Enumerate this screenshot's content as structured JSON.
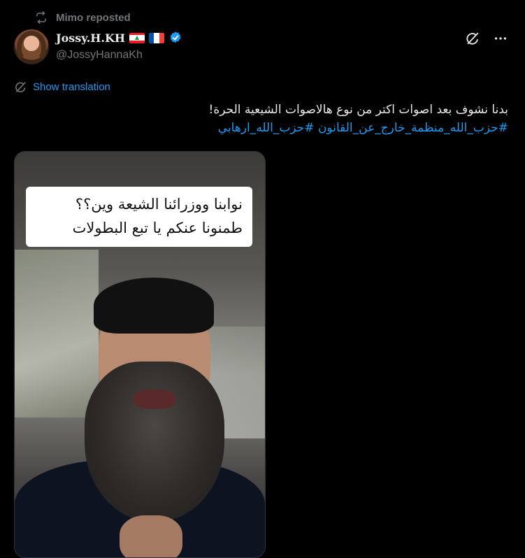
{
  "repost": {
    "label": "Mimo reposted",
    "icon": "repost-icon"
  },
  "author": {
    "display_name": "Jossy.H.KH",
    "flags": [
      "lebanon-flag",
      "france-flag"
    ],
    "verified": true,
    "handle": "@JossyHannaKh"
  },
  "actions": {
    "grok_icon": "grok-icon",
    "more_icon": "more-icon"
  },
  "translation": {
    "label": "Show translation",
    "icon": "translate-icon"
  },
  "tweet": {
    "text": "بدنا نشوف بعد اصوات اكتر من نوع هالاصوات الشيعية الحرة!",
    "hashtags": "#حزب_الله_منظمة_خارج_عن_القانون #حزب_الله_ارهابي"
  },
  "media": {
    "caption_line1": "نوابنا ووزرائنا الشيعة وين؟؟",
    "caption_line2": "طمنونا عنكم يا تبع البطولات"
  },
  "colors": {
    "background": "#000000",
    "text": "#e7e9ea",
    "muted": "#71767b",
    "accent": "#1d9bf0"
  }
}
